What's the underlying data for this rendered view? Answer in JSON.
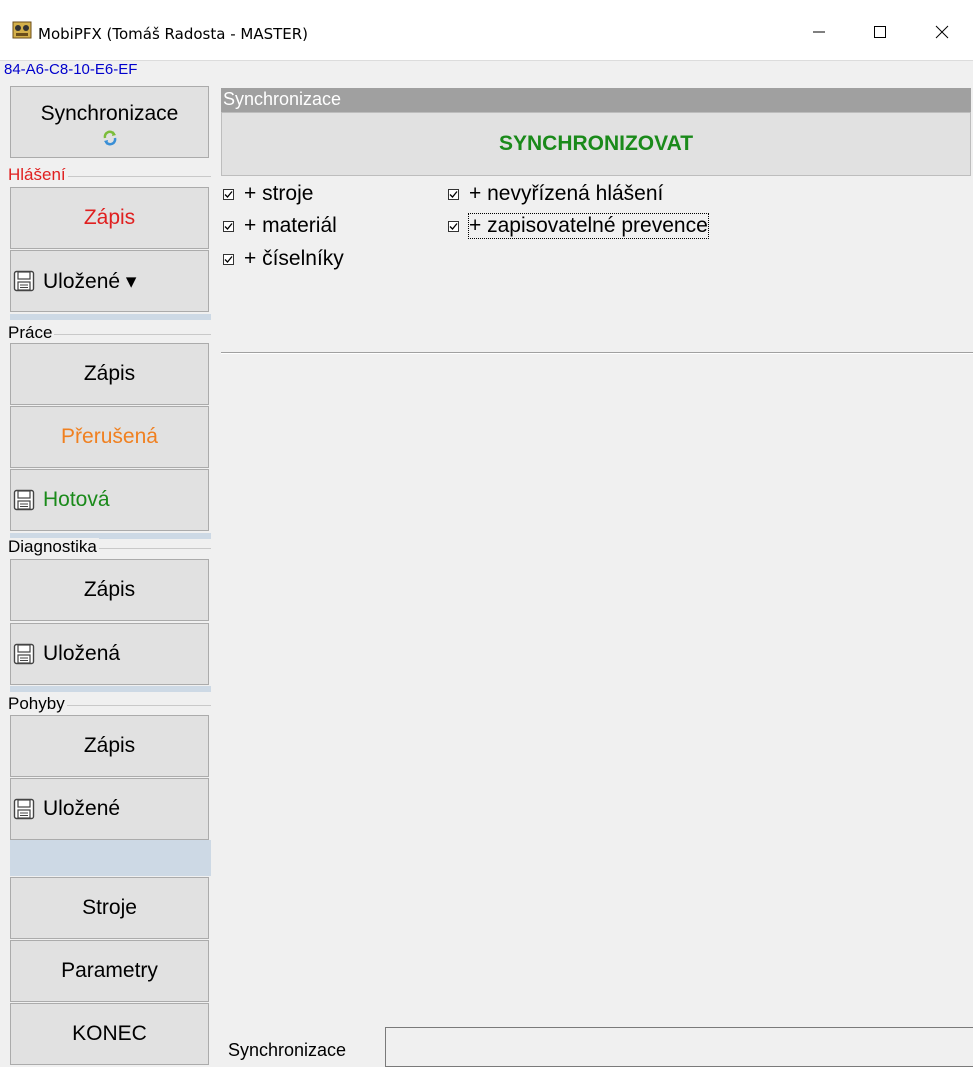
{
  "window": {
    "title": "MobiPFX (Tomáš Radosta - MASTER)",
    "mac_address": "84-A6-C8-10-E6-EF",
    "minimize_symbol": "—",
    "maximize_symbol": "☐",
    "close_symbol": "✕"
  },
  "nav": {
    "sync_button": "Synchronizace",
    "hlaseni": {
      "label": "Hlášení",
      "label_color": "#e02020",
      "zapis": "Zápis",
      "zapis_color": "#e02020",
      "ulozene": "Uložené ▾"
    },
    "prace": {
      "label": "Práce",
      "zapis": "Zápis",
      "prerusena": "Přerušená",
      "prerusena_color": "#f08020",
      "hotova": "Hotová",
      "hotova_color": "#1a8a1a"
    },
    "diagnostika": {
      "label": "Diagnostika",
      "zapis": "Zápis",
      "ulozena": "Uložená"
    },
    "pohyby": {
      "label": "Pohyby",
      "zapis": "Zápis",
      "ulozene": "Uložené"
    },
    "stroje": "Stroje",
    "parametry": "Parametry",
    "konec": "KONEC"
  },
  "main": {
    "header": "Synchronizace",
    "sync_action": "SYNCHRONIZOVAT",
    "options": [
      {
        "label": "+ stroje",
        "checked": true
      },
      {
        "label": "+ materiál",
        "checked": true
      },
      {
        "label": "+ číselníky",
        "checked": true
      },
      {
        "label": "+ nevyřízená hlášení",
        "checked": true
      },
      {
        "label": "+ zapisovatelné prevence",
        "checked": true
      }
    ],
    "status_label": "Synchronizace",
    "status_value": ""
  },
  "colors": {
    "accent_green": "#1a8a1a",
    "header_gray": "#a0a0a0"
  }
}
